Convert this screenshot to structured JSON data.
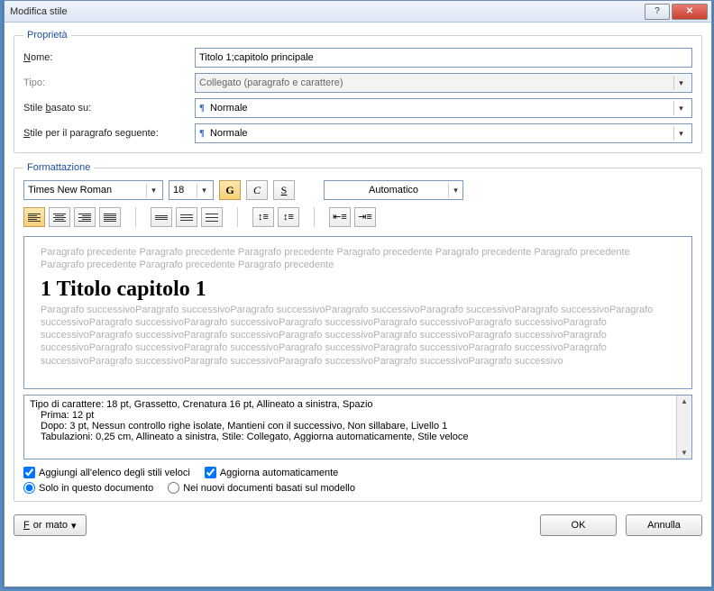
{
  "title": "Modifica stile",
  "groups": {
    "properties": "Proprietà",
    "formatting": "Formattazione"
  },
  "props": {
    "name_label": "Nome:",
    "name_value": "Titolo 1;capitolo principale",
    "type_label": "Tipo:",
    "type_value": "Collegato (paragrafo e carattere)",
    "based_label_pre": "Stile ",
    "based_label_u": "b",
    "based_label_post": "asato su:",
    "based_value": "Normale",
    "next_label_pre": "",
    "next_label_u": "S",
    "next_label_post": "tile per il paragrafo seguente:",
    "next_value": "Normale"
  },
  "fmt": {
    "font": "Times New Roman",
    "size": "18",
    "bold": "G",
    "italic": "C",
    "underline": "S",
    "color": "Automatico"
  },
  "preview": {
    "before": "Paragrafo precedente Paragrafo precedente Paragrafo precedente Paragrafo precedente Paragrafo precedente Paragrafo precedente Paragrafo precedente Paragrafo precedente Paragrafo precedente",
    "title": "1 Titolo capitolo 1",
    "after": "Paragrafo successivoParagrafo successivoParagrafo successivoParagrafo successivoParagrafo successivoParagrafo successivoParagrafo successivoParagrafo successivoParagrafo successivoParagrafo successivoParagrafo successivoParagrafo successivoParagrafo successivoParagrafo successivoParagrafo successivoParagrafo successivoParagrafo successivoParagrafo successivoParagrafo successivoParagrafo successivoParagrafo successivoParagrafo successivoParagrafo successivoParagrafo successivoParagrafo successivoParagrafo successivoParagrafo successivoParagrafo successivoParagrafo successivoParagrafo successivo"
  },
  "desc": {
    "l1": "Tipo di carattere: 18 pt, Grassetto, Crenatura 16 pt, Allineato a sinistra, Spazio",
    "l2": "Prima:  12 pt",
    "l3": "Dopo:  3 pt, Nessun controllo righe isolate, Mantieni con il successivo, Non sillabare, Livello 1",
    "l4": "Tabulazioni:  0,25 cm, Allineato a sinistra, Stile: Collegato, Aggiorna automaticamente, Stile veloce"
  },
  "checks": {
    "quick": "Aggiungi all'elenco degli stili veloci",
    "auto": "Aggiorna automaticamente",
    "doc_only": "Solo in questo documento",
    "template": "Nei nuovi documenti basati sul modello"
  },
  "buttons": {
    "format": "Formato",
    "ok": "OK",
    "cancel": "Annulla"
  }
}
